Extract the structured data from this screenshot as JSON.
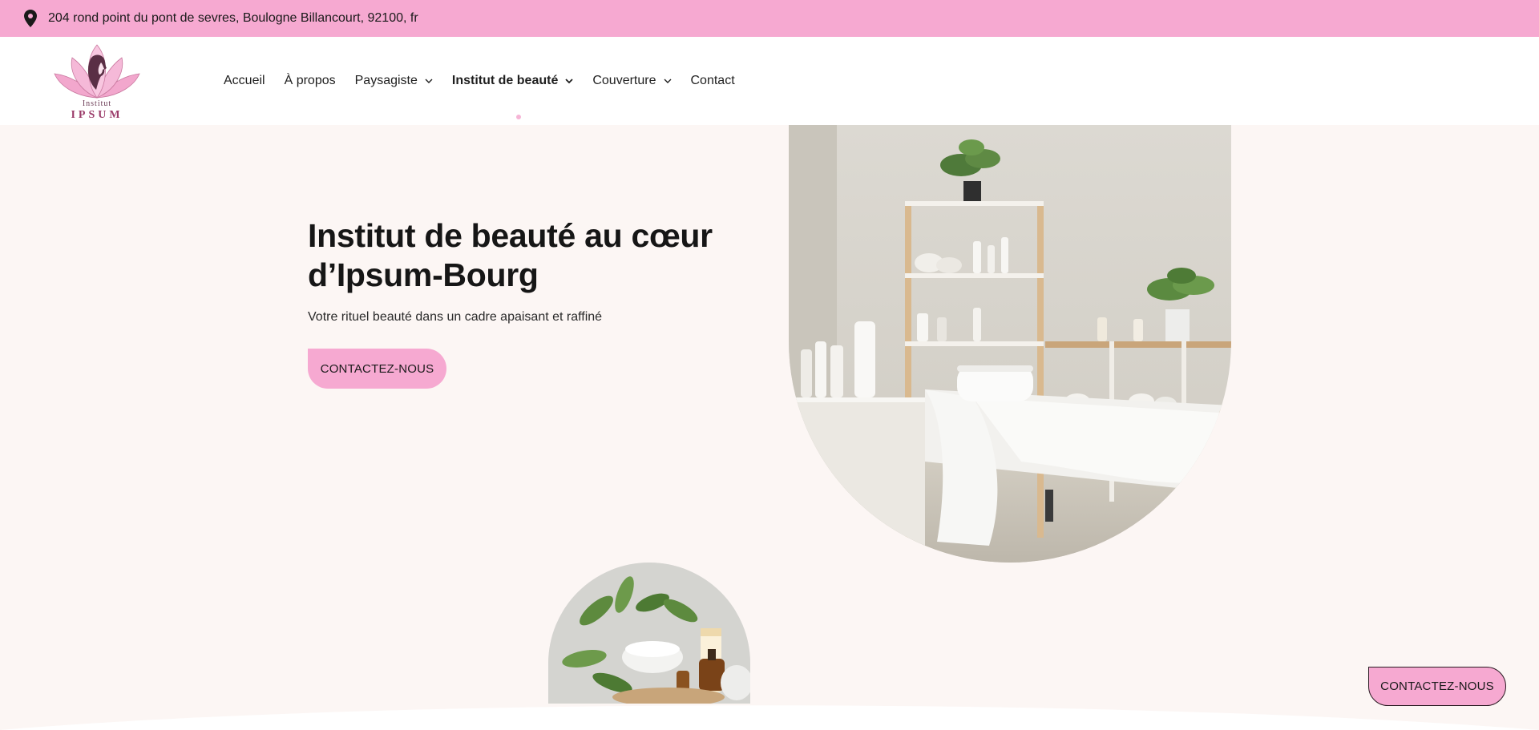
{
  "topbar": {
    "address": "204 rond point du pont de sevres, Boulogne Billancourt, 92100, fr",
    "icon": "map-pin-icon",
    "background": "#f6a9d1"
  },
  "logo": {
    "line1": "Institut",
    "line2": "IPSUM"
  },
  "nav": {
    "items": [
      {
        "label": "Accueil",
        "has_dropdown": false,
        "active": false
      },
      {
        "label": "À propos",
        "has_dropdown": false,
        "active": false
      },
      {
        "label": "Paysagiste",
        "has_dropdown": true,
        "active": false
      },
      {
        "label": "Institut de beauté",
        "has_dropdown": true,
        "active": true
      },
      {
        "label": "Couverture",
        "has_dropdown": true,
        "active": false
      },
      {
        "label": "Contact",
        "has_dropdown": false,
        "active": false
      }
    ]
  },
  "hero": {
    "title": "Institut de beauté au cœur d’Ipsum-Bourg",
    "subtitle": "Votre rituel beauté dans un cadre apaisant et raffiné",
    "cta_label": "CONTACTEZ-NOUS"
  },
  "floating_cta": {
    "label": "CONTACTEZ-NOUS"
  },
  "colors": {
    "accent_pink": "#f6a9d1",
    "page_background": "#fcf6f4",
    "text": "#161616"
  }
}
